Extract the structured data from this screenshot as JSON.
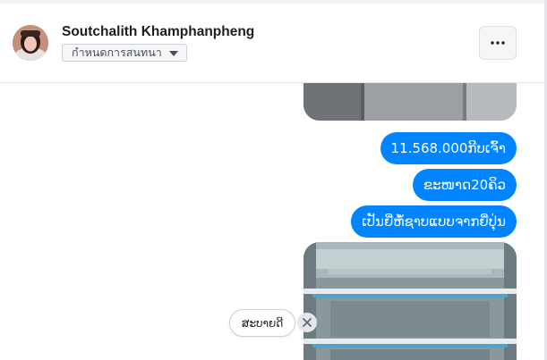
{
  "header": {
    "contact_name": "Soutchalith Khamphanpheng",
    "conversation_settings_label": "กำหนดการสนทนา",
    "more_options_icon": "more-horizontal-icon"
  },
  "messages": [
    {
      "text": "11.568.000ກີບເຈົ້າ"
    },
    {
      "text": "ຂະໜາດ20ຄິວ"
    },
    {
      "text": "ເປັນຍີ່ຫໍ້ຊາບແບບຈາກຍີ່ປຸ່ນ"
    }
  ],
  "quick_reply": {
    "label": "ສະບາຍດີ",
    "dismiss_icon": "close-icon"
  },
  "colors": {
    "bubble": "#0084ff",
    "bubble_text": "#ffffff",
    "header_text": "#1c1e21"
  }
}
